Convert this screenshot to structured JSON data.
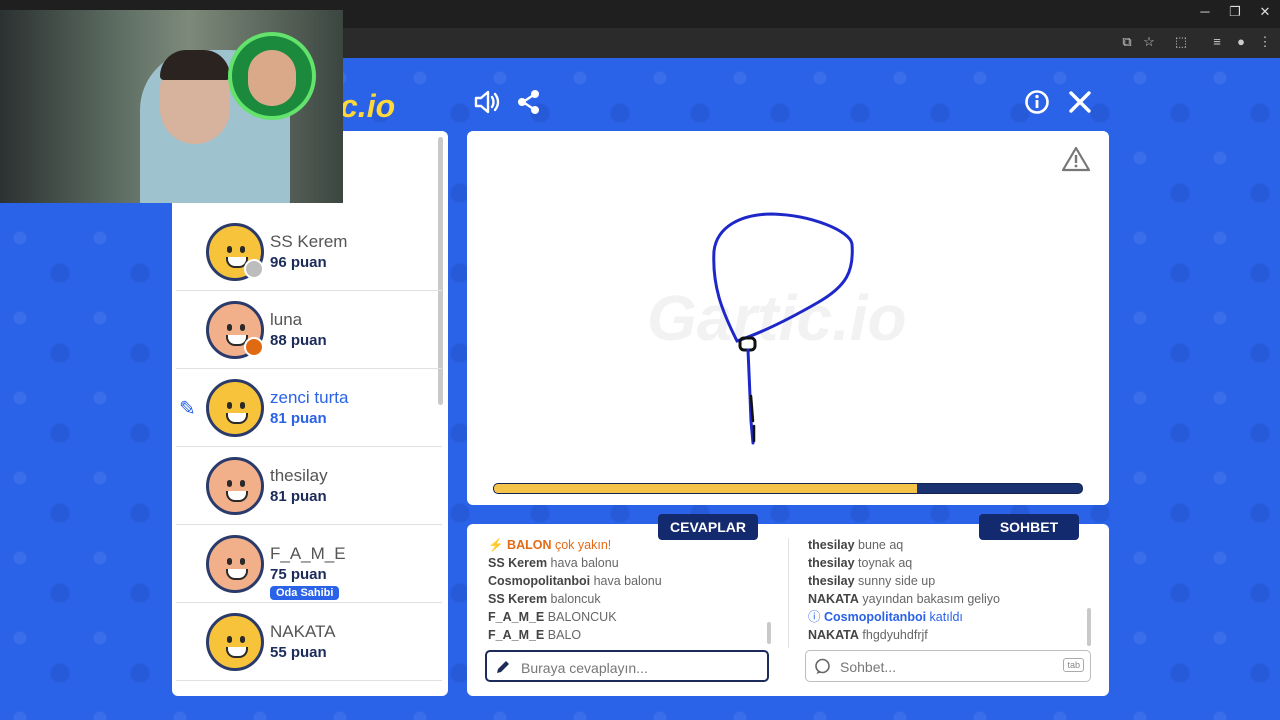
{
  "window": {
    "minimize": "─",
    "maximize": "❐",
    "close": "✕"
  },
  "browser_icons": [
    "cast-icon",
    "star-icon",
    "extension-icon",
    "queue-icon",
    "profile-icon",
    "menu-icon"
  ],
  "logo_text": "c.io",
  "players": [
    {
      "name": "SS Kerem",
      "points": "96 puan",
      "color": "#f7c33b",
      "badge": "#bdbdbd"
    },
    {
      "name": "luna",
      "points": "88 puan",
      "color": "#f2b08a",
      "badge": "#e06a12"
    },
    {
      "name": "zenci turta",
      "points": "81 puan",
      "color": "#f7c33b",
      "active": true
    },
    {
      "name": "thesilay",
      "points": "81 puan",
      "color": "#f2b08a"
    },
    {
      "name": "F_A_M_E",
      "points": "75 puan",
      "color": "#f2b08a",
      "host_badge": "Oda Sahibi"
    },
    {
      "name": "NAKATA",
      "points": "55 puan",
      "color": "#f7c33b"
    }
  ],
  "canvas": {
    "watermark": "Gartic.io",
    "timer_fraction": 0.72
  },
  "answers": {
    "tab_label": "CEVAPLAR",
    "messages": [
      {
        "user": "BALON",
        "text": "çok yakın!",
        "kind": "close"
      },
      {
        "user": "SS Kerem",
        "text": "hava balonu"
      },
      {
        "user": "Cosmopolitanboi",
        "text": "hava balonu"
      },
      {
        "user": "SS Kerem",
        "text": "baloncuk"
      },
      {
        "user": "F_A_M_E",
        "text": "BALONCUK"
      },
      {
        "user": "F_A_M_E",
        "text": "BALO"
      }
    ],
    "placeholder": "Buraya cevaplayın..."
  },
  "chat": {
    "tab_label": "SOHBET",
    "messages": [
      {
        "user": "thesilay",
        "text": "bune aq"
      },
      {
        "user": "thesilay",
        "text": "toynak aq"
      },
      {
        "user": "thesilay",
        "text": "sunny side up"
      },
      {
        "user": "NAKATA",
        "text": "yayından bakasım geliyo"
      },
      {
        "user": "Cosmopolitanboi",
        "text": "katıldı",
        "kind": "sys"
      },
      {
        "user": "NAKATA",
        "text": "fhgdyuhdfrjf"
      }
    ],
    "placeholder": "Sohbet...",
    "tab_key": "tab"
  }
}
